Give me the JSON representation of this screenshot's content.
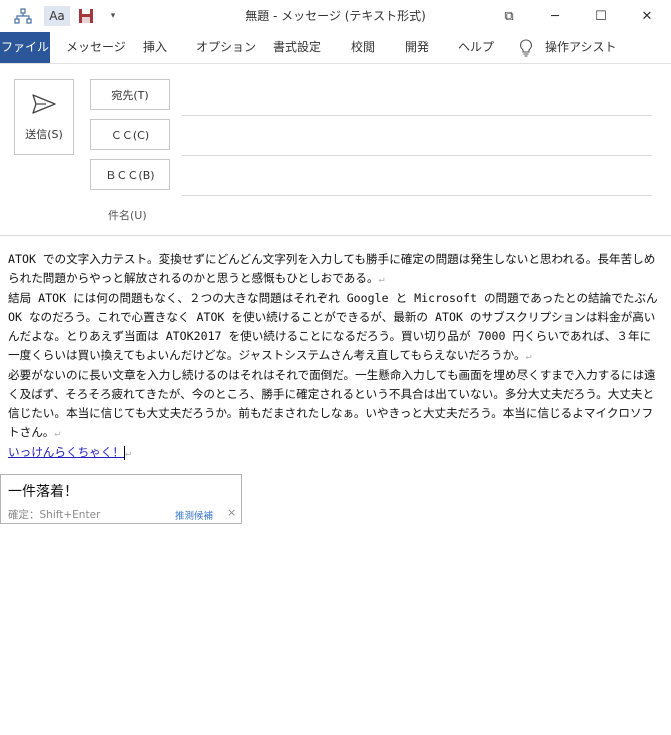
{
  "window": {
    "title": "無題 - メッセージ (テキスト形式)",
    "controls": {
      "ribbon_display": "⧉",
      "minimize": "─",
      "maximize": "☐",
      "close": "✕"
    }
  },
  "quick_access": {
    "format_label": "Aa",
    "more": "▾"
  },
  "ribbon": {
    "tabs": [
      "ファイル",
      "メッセージ",
      "挿入",
      "オプション",
      "書式設定",
      "校閲",
      "開発",
      "ヘルプ",
      "操作アシスト"
    ],
    "active_tab": "ファイル"
  },
  "compose": {
    "send_label": "送信(S)",
    "to_label": "宛先(T)",
    "cc_label": "ＣＣ(C)",
    "bcc_label": "ＢＣＣ(B)",
    "subject_label": "件名(U)",
    "to_value": "",
    "cc_value": "",
    "bcc_value": "",
    "subject_value": ""
  },
  "body": {
    "paragraphs": [
      "ATOK での文字入力テスト。変換せずにどんどん文字列を入力しても勝手に確定の問題は発生しないと思われる。長年苦しめられた問題からやっと解放されるのかと思うと感慨もひとしおである。",
      "結局 ATOK には何の問題もなく、２つの大きな問題はそれぞれ Google と Microsoft の問題であったとの結論でたぶん OK なのだろう。これで心置きなく ATOK を使い続けることができるが、最新の ATOK のサブスクリプションは料金が高いんだよな。とりあえず当面は ATOK2017 を使い続けることになるだろう。買い切り品が 7000 円くらいであれば、３年に一度くらいは買い換えてもよいんだけどな。ジャストシステムさん考え直してもらえないだろうか。",
      "必要がないのに長い文章を入力し続けるのはそれはそれで面倒だ。一生懸命入力しても画面を埋め尽くすまで入力するには遠く及ばず、そろそろ疲れてきたが、今のところ、勝手に確定されるという不具合は出ていない。多分大丈夫だろう。大丈夫と信じたい。本当に信じても大丈夫だろうか。前もだまされたしなぁ。いやきっと大丈夫だろう。本当に信じるよマイクロソフトさん。"
    ],
    "composing_text": "いっけんらくちゃく！",
    "paragraph_mark": "↵"
  },
  "ime": {
    "candidate": "一件落着！",
    "hint": "確定：Shift+Enter",
    "predict_label": "推測候補",
    "close": "×"
  },
  "colors": {
    "file_tab": "#2b579a",
    "compose_text": "#1f1fbf",
    "save_icon": "#a4373a"
  }
}
